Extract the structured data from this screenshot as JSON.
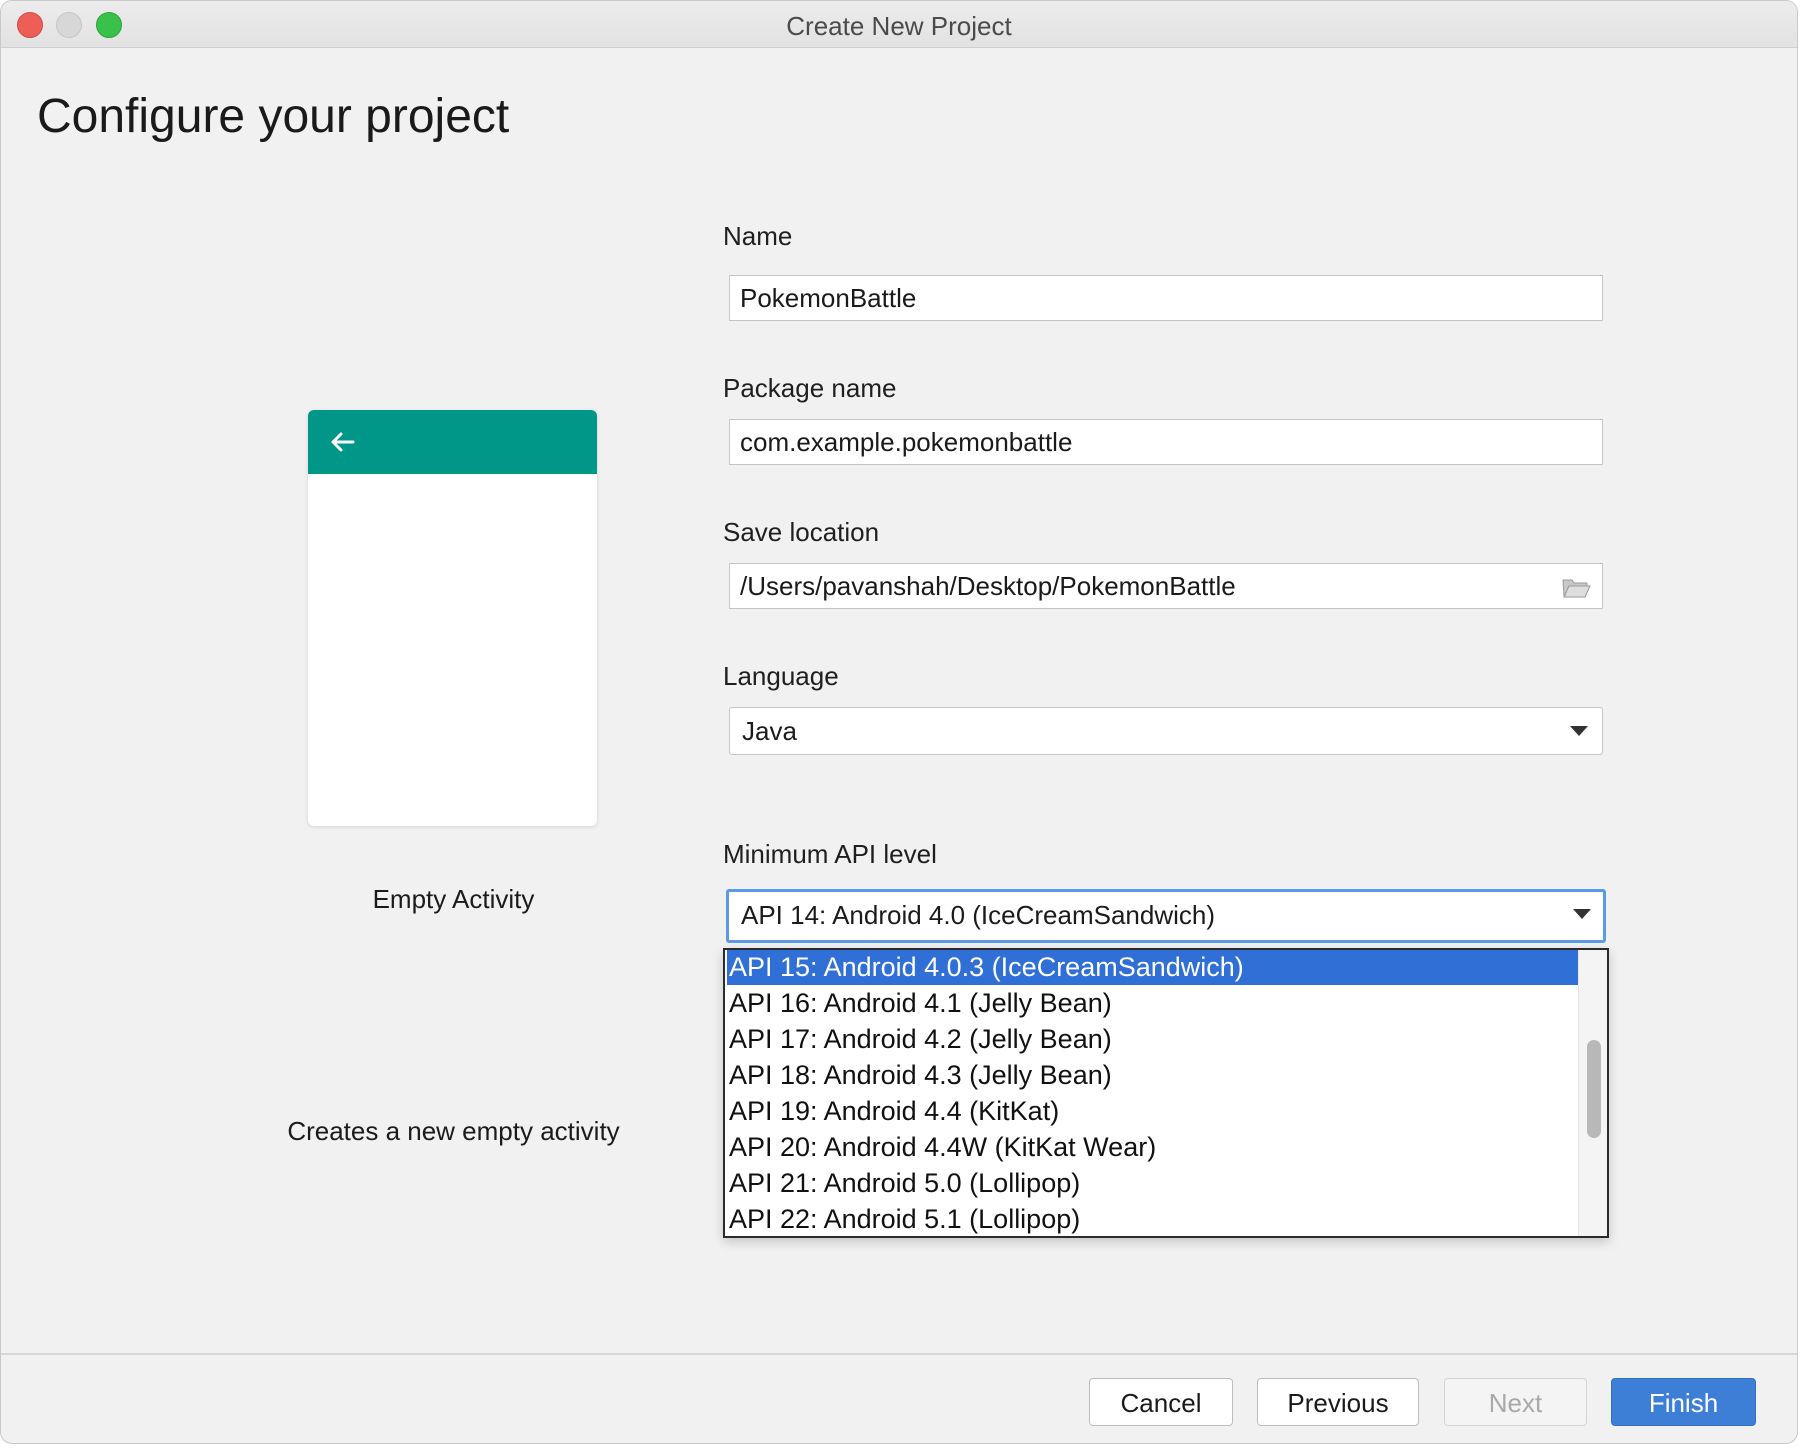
{
  "window": {
    "title": "Create New Project"
  },
  "page": {
    "heading": "Configure your project"
  },
  "template": {
    "name": "Empty Activity",
    "description": "Creates a new empty activity",
    "toolbar_color": "#009688"
  },
  "form": {
    "name_label": "Name",
    "name_value": "PokemonBattle",
    "package_label": "Package name",
    "package_value": "com.example.pokemonbattle",
    "save_label": "Save location",
    "save_value": "/Users/pavanshah/Desktop/PokemonBattle",
    "language_label": "Language",
    "language_value": "Java",
    "api_label": "Minimum API level",
    "api_value": "API 14: Android 4.0 (IceCreamSandwich)"
  },
  "api_options": [
    "API 15: Android 4.0.3 (IceCreamSandwich)",
    "API 16: Android 4.1 (Jelly Bean)",
    "API 17: Android 4.2 (Jelly Bean)",
    "API 18: Android 4.3 (Jelly Bean)",
    "API 19: Android 4.4 (KitKat)",
    "API 20: Android 4.4W (KitKat Wear)",
    "API 21: Android 5.0 (Lollipop)",
    "API 22: Android 5.1 (Lollipop)"
  ],
  "buttons": {
    "cancel": "Cancel",
    "previous": "Previous",
    "next": "Next",
    "finish": "Finish"
  },
  "colors": {
    "accent": "#3d7fd6",
    "selection": "#2f6fd6",
    "focus_ring": "#5a9ae6"
  }
}
